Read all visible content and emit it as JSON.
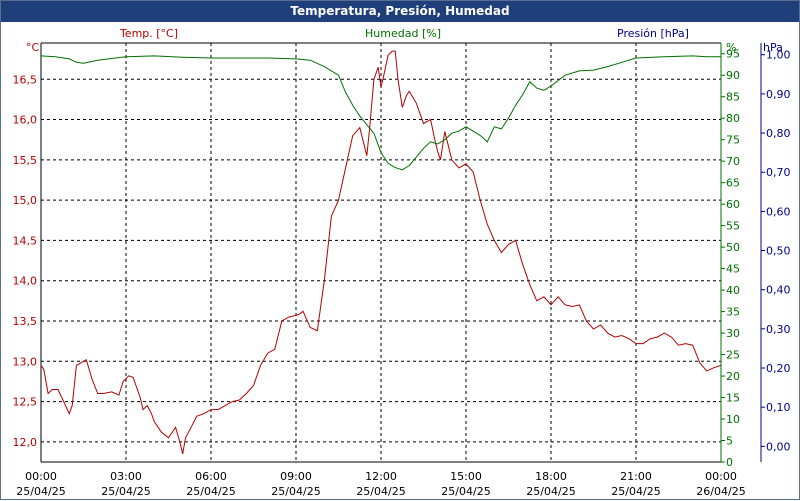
{
  "window": {
    "title": "Temperatura, Presión, Humedad"
  },
  "colors": {
    "temp": "#b30000",
    "hum": "#007000",
    "pres": "#00008b",
    "grid": "#000000",
    "title_bg": "#1f3f7a",
    "axis_black": "#000000"
  },
  "chart_data": {
    "type": "line",
    "title": "Temperatura, Presión, Humedad",
    "grid": true,
    "x_ticks": [
      {
        "time": "00:00",
        "date": "25/04/25"
      },
      {
        "time": "03:00",
        "date": "25/04/25"
      },
      {
        "time": "06:00",
        "date": "25/04/25"
      },
      {
        "time": "09:00",
        "date": "25/04/25"
      },
      {
        "time": "12:00",
        "date": "25/04/25"
      },
      {
        "time": "15:00",
        "date": "25/04/25"
      },
      {
        "time": "18:00",
        "date": "25/04/25"
      },
      {
        "time": "21:00",
        "date": "25/04/25"
      },
      {
        "time": "00:00",
        "date": "26/04/25"
      }
    ],
    "axes": {
      "temp": {
        "unit": "°C",
        "label": "Temp. [°C]",
        "ylim": [
          11.75,
          16.95
        ],
        "ticks": [
          "12,0",
          "12,5",
          "13,0",
          "13,5",
          "14,0",
          "14,5",
          "15,0",
          "15,5",
          "16,0",
          "16,5"
        ],
        "tick_values": [
          12.0,
          12.5,
          13.0,
          13.5,
          14.0,
          14.5,
          15.0,
          15.5,
          16.0,
          16.5
        ]
      },
      "hum": {
        "unit": "%",
        "label": "Humedad [%]",
        "ylim": [
          0,
          97.5
        ],
        "ticks": [
          "0",
          "5",
          "10",
          "15",
          "20",
          "25",
          "30",
          "35",
          "40",
          "45",
          "50",
          "55",
          "60",
          "65",
          "70",
          "75",
          "80",
          "85",
          "90",
          "95"
        ],
        "tick_values": [
          0,
          5,
          10,
          15,
          20,
          25,
          30,
          35,
          40,
          45,
          50,
          55,
          60,
          65,
          70,
          75,
          80,
          85,
          90,
          95
        ]
      },
      "pres": {
        "unit": "hPa",
        "label": "Presión [hPa]",
        "ylim": [
          -0.04,
          1.03
        ],
        "ticks": [
          "0,00",
          "0,10",
          "0,20",
          "0,30",
          "0,40",
          "0,50",
          "0,60",
          "0,70",
          "0,80",
          "0,90",
          "1,00"
        ],
        "tick_values": [
          0.0,
          0.1,
          0.2,
          0.3,
          0.4,
          0.5,
          0.6,
          0.7,
          0.8,
          0.9,
          1.0
        ]
      }
    },
    "series": [
      {
        "name": "Temp. [°C]",
        "axis": "temp",
        "x": [
          0,
          0.1,
          0.25,
          0.4,
          0.6,
          0.8,
          1.0,
          1.1,
          1.25,
          1.4,
          1.6,
          1.8,
          2.0,
          2.2,
          2.5,
          2.75,
          2.9,
          3.1,
          3.25,
          3.5,
          3.6,
          3.75,
          3.9,
          4.0,
          4.25,
          4.5,
          4.75,
          4.9,
          5.0,
          5.1,
          5.25,
          5.5,
          5.75,
          6.0,
          6.25,
          6.5,
          6.75,
          7.0,
          7.25,
          7.5,
          7.75,
          8.0,
          8.25,
          8.5,
          8.75,
          9.0,
          9.1,
          9.25,
          9.5,
          9.75,
          10.0,
          10.25,
          10.5,
          10.75,
          11.0,
          11.25,
          11.5,
          11.6,
          11.75,
          11.9,
          12.0,
          12.1,
          12.25,
          12.4,
          12.5,
          12.6,
          12.75,
          12.9,
          13.0,
          13.25,
          13.5,
          13.75,
          13.9,
          14.0,
          14.1,
          14.25,
          14.5,
          14.75,
          15.0,
          15.25,
          15.5,
          15.75,
          16.0,
          16.25,
          16.5,
          16.75,
          17.0,
          17.25,
          17.5,
          17.75,
          18.0,
          18.25,
          18.5,
          18.75,
          19.0,
          19.25,
          19.5,
          19.75,
          20.0,
          20.25,
          20.5,
          20.75,
          21.0,
          21.25,
          21.5,
          21.75,
          22.0,
          22.25,
          22.5,
          22.75,
          23.0,
          23.25,
          23.5,
          23.75,
          24.0
        ],
        "y": [
          12.95,
          12.9,
          12.6,
          12.65,
          12.65,
          12.5,
          12.35,
          12.45,
          12.95,
          12.98,
          13.02,
          12.78,
          12.6,
          12.6,
          12.62,
          12.58,
          12.75,
          12.82,
          12.8,
          12.55,
          12.4,
          12.45,
          12.35,
          12.25,
          12.12,
          12.05,
          12.18,
          12.0,
          11.85,
          12.05,
          12.15,
          12.32,
          12.35,
          12.4,
          12.4,
          12.45,
          12.5,
          12.52,
          12.6,
          12.7,
          12.95,
          13.1,
          13.15,
          13.5,
          13.55,
          13.57,
          13.58,
          13.62,
          13.42,
          13.38,
          14.0,
          14.8,
          15.0,
          15.4,
          15.8,
          15.9,
          15.55,
          15.9,
          16.5,
          16.65,
          16.4,
          16.55,
          16.8,
          16.85,
          16.85,
          16.5,
          16.15,
          16.3,
          16.35,
          16.2,
          15.95,
          16.0,
          15.75,
          15.6,
          15.5,
          15.85,
          15.5,
          15.4,
          15.45,
          15.35,
          15.0,
          14.7,
          14.5,
          14.35,
          14.45,
          14.5,
          14.2,
          13.95,
          13.75,
          13.8,
          13.7,
          13.8,
          13.7,
          13.68,
          13.7,
          13.5,
          13.4,
          13.45,
          13.35,
          13.3,
          13.32,
          13.28,
          13.22,
          13.22,
          13.28,
          13.3,
          13.35,
          13.3,
          13.2,
          13.22,
          13.2,
          12.98,
          12.88,
          12.92,
          12.95
        ]
      },
      {
        "name": "Humedad [%]",
        "axis": "hum",
        "x": [
          0,
          0.5,
          1.0,
          1.25,
          1.5,
          2.0,
          3.0,
          4.0,
          5.0,
          6.0,
          7.0,
          8.0,
          9.0,
          9.5,
          10.0,
          10.5,
          10.75,
          11.0,
          11.25,
          11.5,
          11.75,
          12.0,
          12.25,
          12.5,
          12.75,
          13.0,
          13.25,
          13.5,
          13.75,
          14.0,
          14.25,
          14.5,
          14.75,
          15.0,
          15.25,
          15.5,
          15.75,
          16.0,
          16.25,
          16.5,
          16.75,
          17.0,
          17.25,
          17.5,
          17.75,
          18.0,
          18.5,
          19.0,
          19.5,
          20.0,
          20.5,
          21.0,
          22.0,
          23.0,
          23.5,
          24.0
        ],
        "y": [
          94.5,
          94.3,
          93.8,
          93.0,
          92.8,
          93.5,
          94.3,
          94.5,
          94.2,
          94.0,
          94.0,
          94.0,
          93.8,
          93.5,
          92.0,
          90.0,
          86.0,
          83.0,
          80.5,
          78.5,
          76.5,
          72.0,
          69.5,
          68.5,
          68.0,
          69.0,
          71.0,
          73.0,
          74.5,
          74.0,
          75.0,
          76.5,
          77.0,
          78.0,
          77.0,
          76.0,
          74.5,
          78.0,
          77.5,
          80.0,
          83.0,
          85.5,
          88.5,
          87.0,
          86.5,
          87.5,
          90.0,
          91.0,
          91.2,
          92.0,
          93.0,
          94.0,
          94.3,
          94.5,
          94.3,
          94.3
        ]
      }
    ],
    "legend": [
      "Temp. [°C]",
      "Humedad [%]",
      "Presión [hPa]"
    ]
  }
}
